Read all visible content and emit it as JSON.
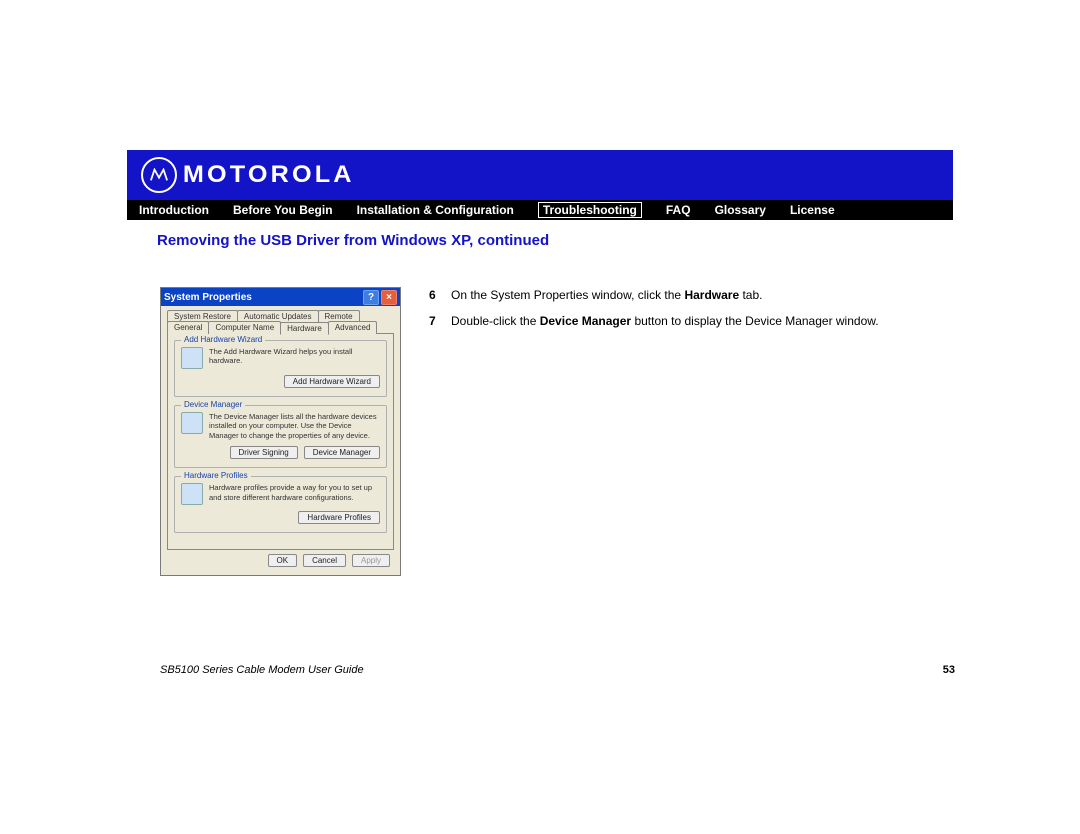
{
  "brand": "MOTOROLA",
  "nav": {
    "items": [
      {
        "label": "Introduction"
      },
      {
        "label": "Before You Begin"
      },
      {
        "label": "Installation & Configuration"
      },
      {
        "label": "Troubleshooting",
        "active": true
      },
      {
        "label": "FAQ"
      },
      {
        "label": "Glossary"
      },
      {
        "label": "License"
      }
    ]
  },
  "section_title": "Removing the USB Driver from Windows XP, continued",
  "dialog": {
    "title": "System Properties",
    "tabs_row1": [
      "System Restore",
      "Automatic Updates",
      "Remote"
    ],
    "tabs_row2": [
      "General",
      "Computer Name",
      "Hardware",
      "Advanced"
    ],
    "active_tab": "Hardware",
    "groups": {
      "add_hw": {
        "legend": "Add Hardware Wizard",
        "text": "The Add Hardware Wizard helps you install hardware.",
        "button": "Add Hardware Wizard"
      },
      "dev_mgr": {
        "legend": "Device Manager",
        "text": "The Device Manager lists all the hardware devices installed on your computer. Use the Device Manager to change the properties of any device.",
        "buttons": [
          "Driver Signing",
          "Device Manager"
        ]
      },
      "hw_prof": {
        "legend": "Hardware Profiles",
        "text": "Hardware profiles provide a way for you to set up and store different hardware configurations.",
        "button": "Hardware Profiles"
      }
    },
    "footer_buttons": {
      "ok": "OK",
      "cancel": "Cancel",
      "apply": "Apply"
    }
  },
  "steps": [
    {
      "num": "6",
      "pre": "On the System Properties window, click the ",
      "bold": "Hardware",
      "post": " tab."
    },
    {
      "num": "7",
      "pre": "Double-click the ",
      "bold": "Device Manager",
      "post": " button to display the Device Manager window."
    }
  ],
  "footer": {
    "guide": "SB5100 Series Cable Modem User Guide",
    "page": "53"
  }
}
